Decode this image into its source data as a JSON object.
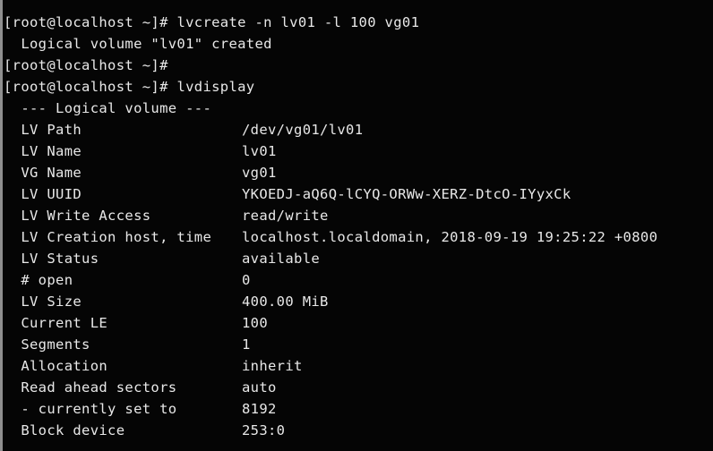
{
  "terminal": {
    "background_color": "#050505",
    "foreground_color": "#e8e8e8",
    "border_color": "#8f8f8f",
    "prompt": "[root@localhost ~]# ",
    "indent": "  ",
    "value_column_x": "266px"
  },
  "session": {
    "command_1": "lvcreate -n lv01 -l 100 vg01",
    "output_1": "  Logical volume \"lv01\" created",
    "prompt_only": "[root@localhost ~]# ",
    "command_2": "lvdisplay",
    "section_header": "  --- Logical volume ---"
  },
  "lvdisplay": {
    "rows": [
      {
        "label": "  LV Path",
        "value": "/dev/vg01/lv01"
      },
      {
        "label": "  LV Name",
        "value": "lv01"
      },
      {
        "label": "  VG Name",
        "value": "vg01"
      },
      {
        "label": "  LV UUID",
        "value": "YKOEDJ-aQ6Q-lCYQ-ORWw-XERZ-DtcO-IYyxCk"
      },
      {
        "label": "  LV Write Access",
        "value": "read/write"
      },
      {
        "label": "  LV Creation host, time",
        "value": "localhost.localdomain, 2018-09-19 19:25:22 +0800"
      },
      {
        "label": "  LV Status",
        "value": "available"
      },
      {
        "label": "  # open",
        "value": "0"
      },
      {
        "label": "  LV Size",
        "value": "400.00 MiB"
      },
      {
        "label": "  Current LE",
        "value": "100"
      },
      {
        "label": "  Segments",
        "value": "1"
      },
      {
        "label": "  Allocation",
        "value": "inherit"
      },
      {
        "label": "  Read ahead sectors",
        "value": "auto"
      },
      {
        "label": "  - currently set to",
        "value": "8192"
      },
      {
        "label": "  Block device",
        "value": "253:0"
      }
    ]
  },
  "prompt_lines": {
    "line_1_prompt": "[root@localhost ~]# ",
    "line_1_command": "lvcreate -n lv01 -l 100 vg01",
    "line_3_prompt": "[root@localhost ~]# ",
    "line_4_prompt": "[root@localhost ~]# ",
    "line_4_command": "lvdisplay"
  }
}
